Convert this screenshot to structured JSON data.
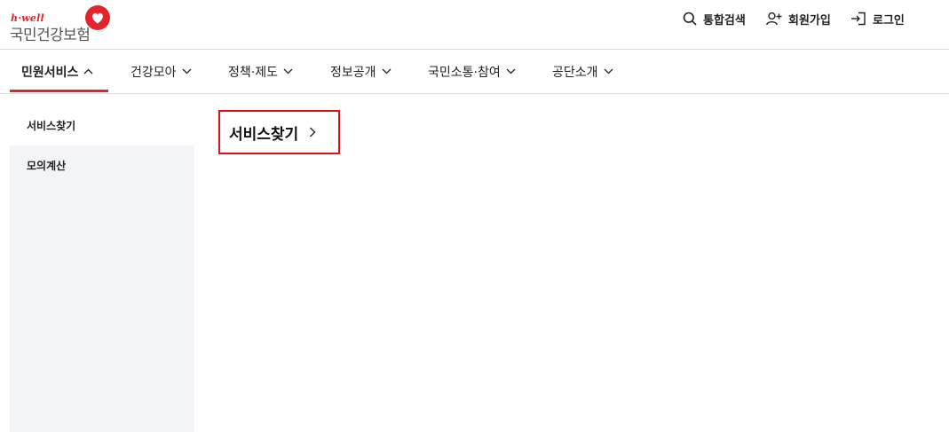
{
  "logo": {
    "tagline": "h·well",
    "name": "국민건강보험"
  },
  "utility": {
    "search": "통합검색",
    "signup": "회원가입",
    "login": "로그인"
  },
  "gnb": [
    {
      "label": "민원서비스",
      "active": true,
      "icon": "chevron-up-icon"
    },
    {
      "label": "건강모아",
      "icon": "chevron-down-icon"
    },
    {
      "label": "정책·제도",
      "icon": "chevron-down-icon"
    },
    {
      "label": "정보공개",
      "icon": "chevron-down-icon"
    },
    {
      "label": "국민소통·참여",
      "icon": "chevron-down-icon"
    },
    {
      "label": "공단소개",
      "icon": "chevron-down-icon"
    }
  ],
  "sidebar": {
    "items": [
      {
        "label": "서비스찾기",
        "active": true
      },
      {
        "label": "모의계산"
      }
    ]
  },
  "main": {
    "title": "서비스찾기"
  },
  "colors": {
    "accent": "#e0262b",
    "sidebar_bg": "#f4f5f9",
    "highlight_border": "#e0101a"
  }
}
